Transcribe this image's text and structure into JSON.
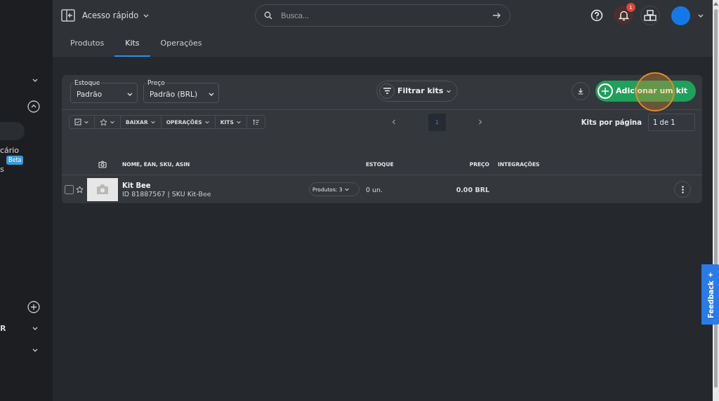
{
  "header": {
    "quick_access": "Acesso rápido",
    "search": {
      "placeholder": "Busca..."
    },
    "notification_count": "1"
  },
  "tabs": [
    {
      "label": "Produtos",
      "selected": false
    },
    {
      "label": "Kits",
      "selected": true
    },
    {
      "label": "Operações",
      "selected": false
    }
  ],
  "sidebar": {
    "items": [
      {
        "kind": "chevron"
      },
      {
        "kind": "collapse"
      },
      {
        "kind": "active",
        "selected": true
      },
      {
        "kind": "text",
        "label": "cário",
        "selected": false
      },
      {
        "kind": "badge",
        "label": "Beta"
      },
      {
        "kind": "text",
        "label": "s",
        "selected": false
      },
      {
        "kind": "add"
      },
      {
        "kind": "text-chevron",
        "label": "R",
        "selected": false
      },
      {
        "kind": "chevron"
      }
    ]
  },
  "filters": [
    {
      "label": "Estoque",
      "value": "Padrão"
    },
    {
      "label": "Preço",
      "value": "Padrão (BRL)"
    }
  ],
  "filter_button": "Filtrar kits",
  "add_button": "Adicionar um kit",
  "toolbar": [
    {
      "kind": "checkbox"
    },
    {
      "kind": "star"
    },
    {
      "kind": "text",
      "label": "BAIXAR"
    },
    {
      "kind": "text",
      "label": "OPERAÇÕES"
    },
    {
      "kind": "text",
      "label": "KITS"
    },
    {
      "kind": "sort"
    }
  ],
  "pagination": {
    "page": "1",
    "per_page_label": "Kits por página",
    "per_page_value": "1 de 1"
  },
  "columns": [
    "NOME, EAN, SKU, ASIN",
    "ESTOQUE",
    "PREÇO",
    "INTEGRAÇÕES"
  ],
  "rows": [
    {
      "name": "Kit Bee",
      "details": "ID 81887567 | SKU Kit-Bee",
      "products": "Produtos: 3",
      "stock": "0 un.",
      "price": "0.00 BRL",
      "checked": false,
      "starred": false
    }
  ],
  "feedback": "Feedback"
}
